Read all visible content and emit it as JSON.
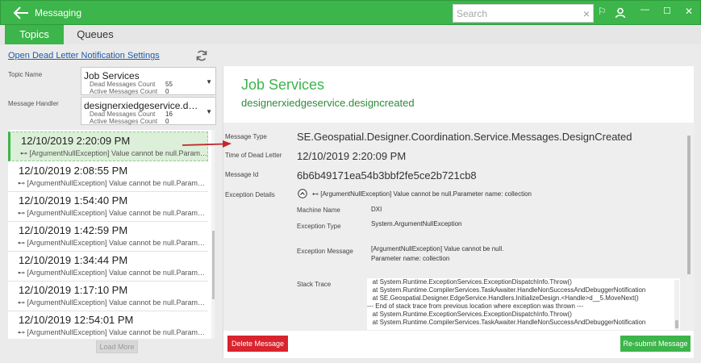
{
  "app": {
    "title": "Messaging"
  },
  "search": {
    "placeholder": "Search",
    "clear_glyph": "×"
  },
  "titlebar_icons": [
    "back-arrow-icon",
    "flag-icon",
    "user-icon",
    "minimize-icon",
    "maximize-icon",
    "close-icon"
  ],
  "window_controls": {
    "flag": "⚐",
    "minimize": "—",
    "maximize": "☐",
    "close": "✕"
  },
  "tabs": [
    {
      "label": "Topics",
      "active": true
    },
    {
      "label": "Queues",
      "active": false
    }
  ],
  "left": {
    "link": "Open Dead Letter Notification Settings",
    "topic_label": "Topic Name",
    "handler_label": "Message Handler",
    "topic": {
      "name": "Job Services",
      "dead_label": "Dead Messages Count",
      "dead": "55",
      "active_label": "Active Messages Count",
      "active": "0"
    },
    "handler": {
      "name": "designerxiedgeservice.designcreated",
      "dead_label": "Dead Messages Count",
      "dead": "16",
      "active_label": "Active Messages Count",
      "active": "0"
    },
    "messages": [
      {
        "time": "12/10/2019 2:20:09 PM",
        "error": "⊷ [ArgumentNullException] Value cannot be null.Parameter name: collection",
        "selected": true
      },
      {
        "time": "12/10/2019 2:08:55 PM",
        "error": "⊷ [ArgumentNullException] Value cannot be null.Parameter name: collection",
        "selected": false
      },
      {
        "time": "12/10/2019 1:54:40 PM",
        "error": "⊷ [ArgumentNullException] Value cannot be null.Parameter name: collection",
        "selected": false
      },
      {
        "time": "12/10/2019 1:42:59 PM",
        "error": "⊷ [ArgumentNullException] Value cannot be null.Parameter name: collection",
        "selected": false
      },
      {
        "time": "12/10/2019 1:34:44 PM",
        "error": "⊷ [ArgumentNullException] Value cannot be null.Parameter name: collection",
        "selected": false
      },
      {
        "time": "12/10/2019 1:17:10 PM",
        "error": "⊷ [ArgumentNullException] Value cannot be null.Parameter name: collection",
        "selected": false
      },
      {
        "time": "12/10/2019 12:54:01 PM",
        "error": "⊷ [ArgumentNullException] Value cannot be null.Parameter name: collection",
        "selected": false
      }
    ],
    "load_more": "Load More"
  },
  "detail": {
    "topic": "Job Services",
    "handler": "designerxiedgeservice.designcreated",
    "message_type_label": "Message Type",
    "message_type": "SE.Geospatial.Designer.Coordination.Service.Messages.DesignCreated",
    "time_label": "Time of Dead Letter",
    "time": "12/10/2019 2:20:09 PM",
    "id_label": "Message Id",
    "id": "6b6b49171ea54b3bbf2fe5ce2b721cb8",
    "exception_label": "Exception Details",
    "exception_summary": "⊷ [ArgumentNullException] Value cannot be null.Parameter name: collection",
    "machine_label": "Machine Name",
    "machine": "DXI",
    "exc_type_label": "Exception Type",
    "exc_type": "System.ArgumentNullException",
    "exc_msg_label": "Exception Message",
    "exc_msg_line1": "[ArgumentNullException] Value cannot be null.",
    "exc_msg_line2": "Parameter name: collection",
    "stack_label": "Stack Trace",
    "stack": [
      "   at System.Runtime.ExceptionServices.ExceptionDispatchInfo.Throw()",
      "   at System.Runtime.CompilerServices.TaskAwaiter.HandleNonSuccessAndDebuggerNotification",
      "   at SE.Geospatial.Designer.EdgeService.Handlers.InitializeDesign.<Handle>d__5.MoveNext()",
      "--- End of stack trace from previous location where exception was thrown ---",
      "   at System.Runtime.ExceptionServices.ExceptionDispatchInfo.Throw()",
      "   at System.Runtime.CompilerServices.TaskAwaiter.HandleNonSuccessAndDebuggerNotification"
    ]
  },
  "buttons": {
    "delete": "Delete Message",
    "resubmit": "Re-submit Message"
  },
  "colors": {
    "accent": "#3cb54a",
    "danger": "#d9232d",
    "link": "#1e5aa8",
    "arrow": "#c0282d"
  }
}
